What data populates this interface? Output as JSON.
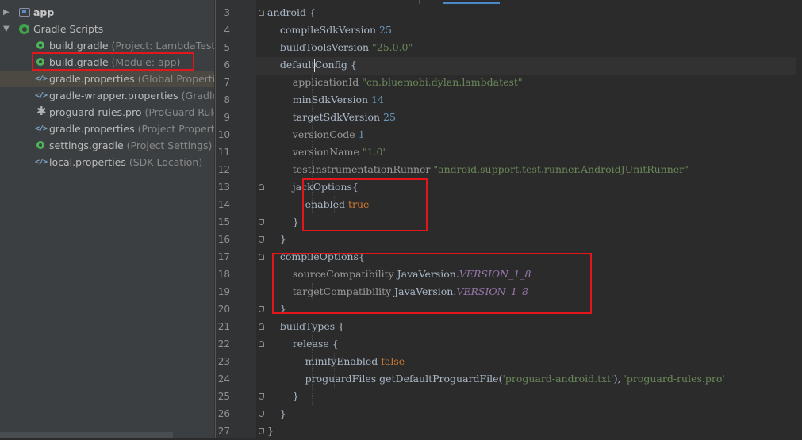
{
  "project_tree": {
    "items": [
      {
        "label": "app",
        "hint": "",
        "icon": "folder-icon"
      },
      {
        "label": "Gradle Scripts",
        "hint": "",
        "icon": "gradle-icon"
      },
      {
        "label": "build.gradle",
        "hint": "(Project: LambdaTest)",
        "icon": "gradle-file-icon"
      },
      {
        "label": "build.gradle",
        "hint": "(Module: app)",
        "icon": "gradle-file-icon"
      },
      {
        "label": "gradle.properties",
        "hint": "(Global Properties)",
        "icon": "properties-file-icon"
      },
      {
        "label": "gradle-wrapper.properties",
        "hint": "(Gradle Version)",
        "icon": "properties-file-icon"
      },
      {
        "label": "proguard-rules.pro",
        "hint": "(ProGuard Rules for app)",
        "icon": "proguard-file-icon"
      },
      {
        "label": "gradle.properties",
        "hint": "(Project Properties)",
        "icon": "properties-file-icon"
      },
      {
        "label": "settings.gradle",
        "hint": "(Project Settings)",
        "icon": "gradle-file-icon"
      },
      {
        "label": "local.properties",
        "hint": "(SDK Location)",
        "icon": "properties-file-icon"
      }
    ]
  },
  "editor": {
    "line_numbers": [
      "3",
      "4",
      "5",
      "6",
      "7",
      "8",
      "9",
      "10",
      "11",
      "12",
      "13",
      "14",
      "15",
      "16",
      "17",
      "18",
      "19",
      "20",
      "21",
      "22",
      "23",
      "24",
      "25",
      "26",
      "27"
    ],
    "lines": [
      {
        "p": [
          "android {"
        ]
      },
      {
        "p": [
          "    compileSdkVersion ",
          "25"
        ]
      },
      {
        "p": [
          "    buildToolsVersion ",
          "\"25.0.0\""
        ]
      },
      {
        "p": [
          "    default",
          "Config {"
        ]
      },
      {
        "p": [
          "        applicationId ",
          "\"cn.bluemobi.dylan.lambdatest\""
        ]
      },
      {
        "p": [
          "        minSdkVersion ",
          "14"
        ]
      },
      {
        "p": [
          "        targetSdkVersion ",
          "25"
        ]
      },
      {
        "p": [
          "        versionCode ",
          "1"
        ]
      },
      {
        "p": [
          "        versionName ",
          "\"1.0\""
        ]
      },
      {
        "p": [
          "        testInstrumentationRunner ",
          "\"android.support.test.runner.AndroidJUnitRunner\""
        ]
      },
      {
        "p": [
          "        jackOptions{"
        ]
      },
      {
        "p": [
          "            enabled ",
          "true"
        ]
      },
      {
        "p": [
          "        }"
        ]
      },
      {
        "p": [
          "    }"
        ]
      },
      {
        "p": [
          "    compileOptions{"
        ]
      },
      {
        "p": [
          "        sourceCompatibility ",
          "JavaVersion.",
          "VERSION_1_8"
        ]
      },
      {
        "p": [
          "        targetCompatibility ",
          "JavaVersion.",
          "VERSION_1_8"
        ]
      },
      {
        "p": [
          "    }"
        ]
      },
      {
        "p": [
          "    buildTypes {"
        ]
      },
      {
        "p": [
          "        release {"
        ]
      },
      {
        "p": [
          "            minifyEnabled ",
          "false"
        ]
      },
      {
        "p": [
          "            proguardFiles getDefaultProguardFile(",
          "'proguard-android.txt'",
          "), ",
          "'proguard-rules.pro'"
        ]
      },
      {
        "p": [
          "        }"
        ]
      },
      {
        "p": [
          "    }"
        ]
      },
      {
        "p": [
          "}"
        ]
      }
    ]
  },
  "colors": {
    "string": "#6a8759",
    "keyword": "#cc7832",
    "constant": "#9876aa",
    "highlight_box": "#e3161b",
    "tree_selected": "#0d293e"
  }
}
